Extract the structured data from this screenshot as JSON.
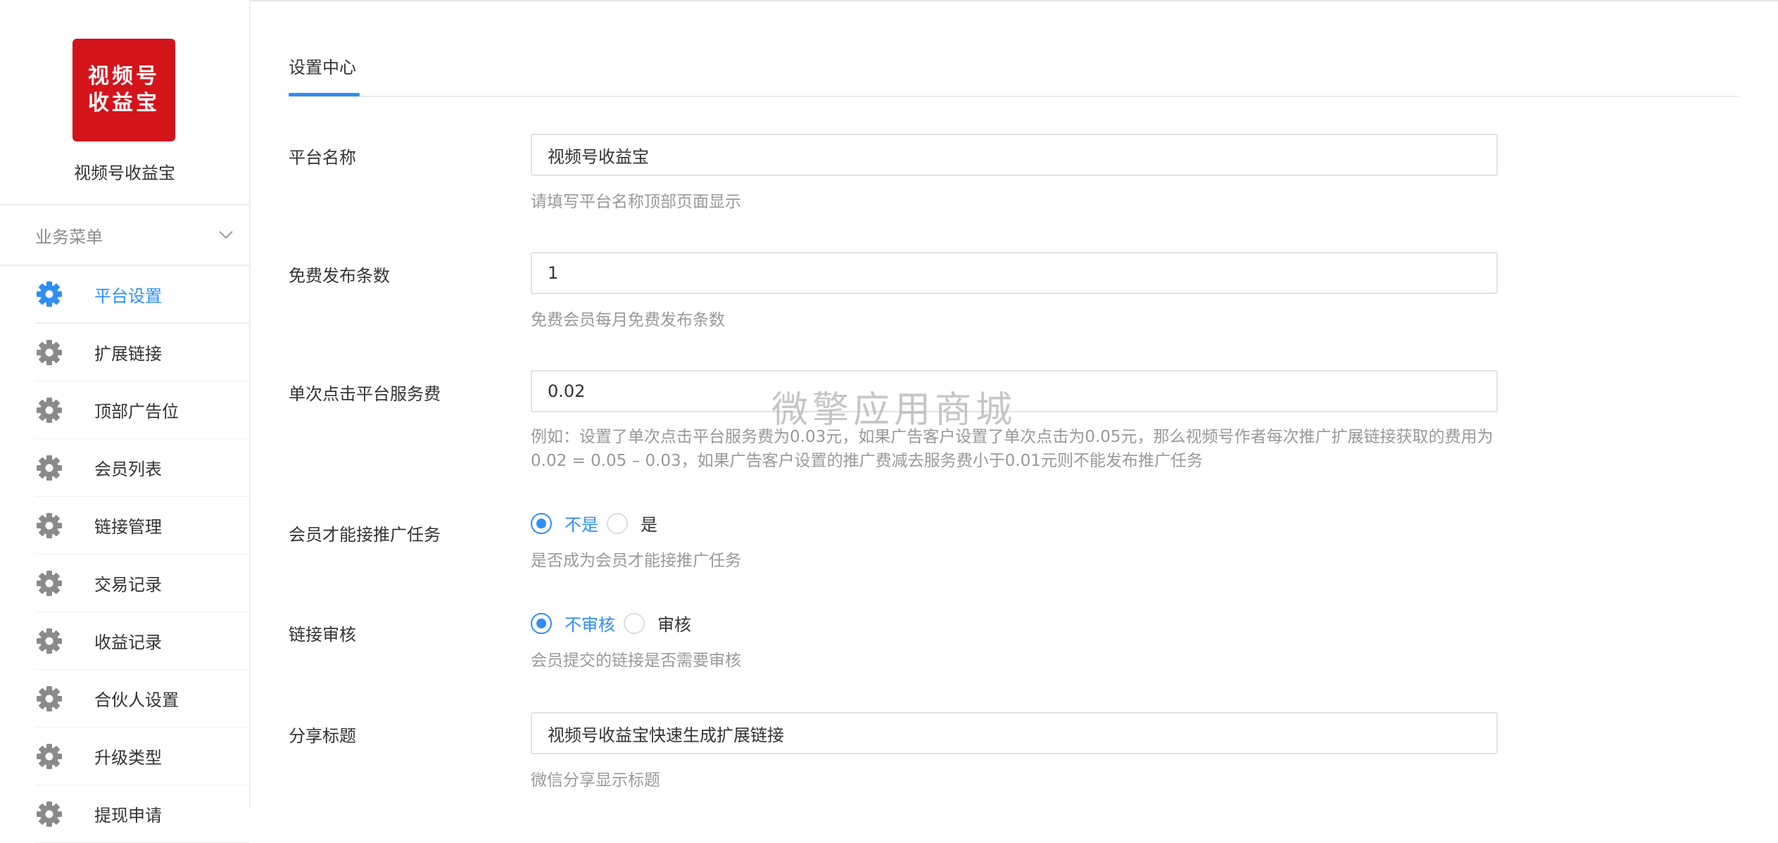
{
  "brand": {
    "logo_line1": "视频号",
    "logo_line2": "收益宝",
    "name": "视频号收益宝",
    "logo_color": "#d3141b"
  },
  "sidebar": {
    "menu_header": "业务菜单",
    "items": [
      {
        "label": "平台设置",
        "icon": "gear-icon",
        "active": true
      },
      {
        "label": "扩展链接",
        "icon": "gear-icon"
      },
      {
        "label": "顶部广告位",
        "icon": "gear-icon"
      },
      {
        "label": "会员列表",
        "icon": "gear-icon"
      },
      {
        "label": "链接管理",
        "icon": "gear-icon"
      },
      {
        "label": "交易记录",
        "icon": "gear-icon"
      },
      {
        "label": "收益记录",
        "icon": "gear-icon"
      },
      {
        "label": "合伙人设置",
        "icon": "gear-icon"
      },
      {
        "label": "升级类型",
        "icon": "gear-icon"
      },
      {
        "label": "提现申请",
        "icon": "gear-icon"
      }
    ]
  },
  "main": {
    "tab": "设置中心",
    "fields": {
      "platform_name": {
        "label": "平台名称",
        "value": "视频号收益宝",
        "hint": "请填写平台名称顶部页面显示"
      },
      "free_posts": {
        "label": "免费发布条数",
        "value": "1",
        "hint": "免费会员每月免费发布条数"
      },
      "click_fee": {
        "label": "单次点击平台服务费",
        "value": "0.02",
        "hint": "例如：设置了单次点击平台服务费为0.03元，如果广告客户设置了单次点击为0.05元，那么视频号作者每次推广扩展链接获取的费用为0.02 = 0.05 – 0.03，如果广告客户设置的推广费减去服务费小于0.01元则不能发布推广任务"
      },
      "member_only": {
        "label": "会员才能接推广任务",
        "options": [
          "不是",
          "是"
        ],
        "selected": "不是",
        "hint": "是否成为会员才能接推广任务"
      },
      "link_review": {
        "label": "链接审核",
        "options": [
          "不审核",
          "审核"
        ],
        "selected": "不审核",
        "hint": "会员提交的链接是否需要审核"
      },
      "share_title": {
        "label": "分享标题",
        "value": "视频号收益宝快速生成扩展链接",
        "hint": "微信分享显示标题"
      }
    }
  },
  "watermark": "微擎应用商城",
  "colors": {
    "accent": "#2f8ef5",
    "icon_gray": "#8a8a8a"
  }
}
